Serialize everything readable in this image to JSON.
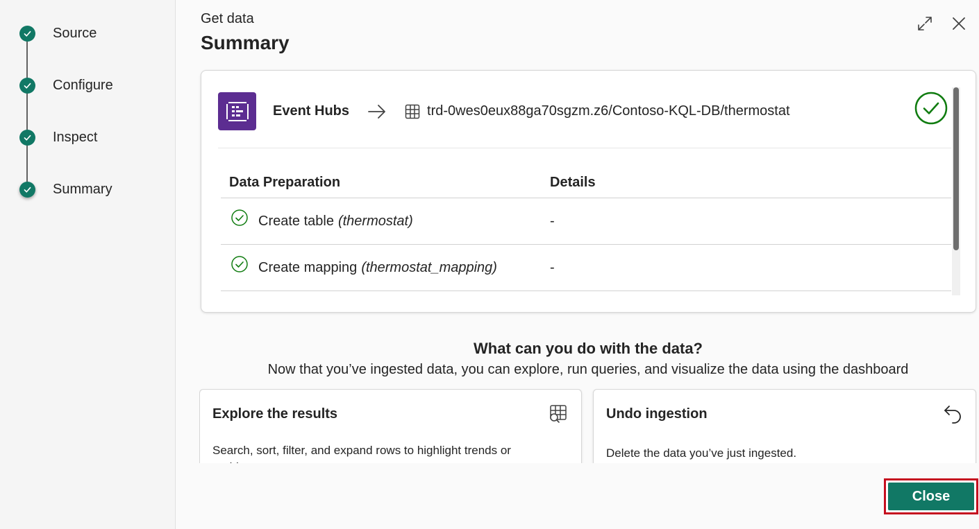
{
  "stepper": {
    "steps": [
      {
        "label": "Source",
        "state": "completed"
      },
      {
        "label": "Configure",
        "state": "completed"
      },
      {
        "label": "Inspect",
        "state": "completed"
      },
      {
        "label": "Summary",
        "state": "current"
      }
    ]
  },
  "header": {
    "eyebrow": "Get data",
    "title": "Summary",
    "expand_icon": "expand-diagonal-icon",
    "close_icon": "close-icon"
  },
  "summary": {
    "source_icon": "event-hubs-icon",
    "source": "Event Hubs",
    "arrow_icon": "arrow-right-icon",
    "destination_icon": "table-grid-icon",
    "destination": "trd-0wes0eux88ga70sgzm.z6/Contoso-KQL-DB/thermostat",
    "status_icon": "success-check-circle-icon",
    "table": {
      "headers": [
        "Data Preparation",
        "Details"
      ],
      "rows": [
        {
          "action": "Create table",
          "target": "(thermostat)",
          "details": "-"
        },
        {
          "action": "Create mapping",
          "target": "(thermostat_mapping)",
          "details": "-"
        }
      ]
    }
  },
  "next_steps": {
    "title": "What can you do with the data?",
    "subtitle": "Now that you’ve ingested data, you can explore, run queries, and visualize the data using the dashboard",
    "cards": [
      {
        "title": "Explore the results",
        "icon": "table-search-icon",
        "description": "Search, sort, filter, and expand rows to highlight trends or problems."
      },
      {
        "title": "Undo ingestion",
        "icon": "undo-arrow-icon",
        "description": "Delete the data you’ve just ingested."
      }
    ]
  },
  "footer": {
    "close_label": "Close"
  },
  "colors": {
    "accent": "#117865",
    "event_hubs": "#5c2d91",
    "success": "#107c10",
    "highlight": "#c50f1f"
  }
}
